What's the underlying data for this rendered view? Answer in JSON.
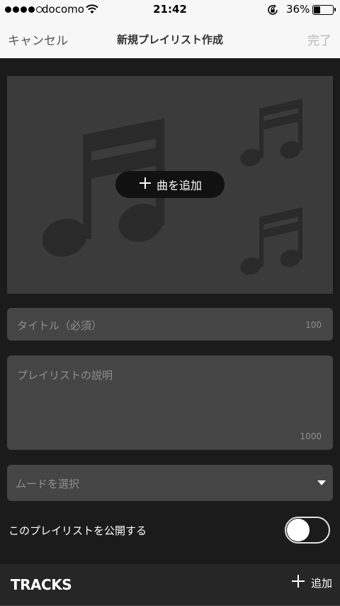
{
  "status_bar": {
    "carrier": "docomo",
    "time": "21:42",
    "battery_percent": "36%",
    "battery_level": 0.36,
    "signal_bars_filled": 4
  },
  "nav": {
    "cancel_label": "キャンセル",
    "title": "新規プレイリスト作成",
    "done_label": "完了"
  },
  "artwork": {
    "add_song_label": "曲を追加"
  },
  "form": {
    "title_placeholder": "タイトル（必須）",
    "title_max": "100",
    "description_placeholder": "プレイリストの説明",
    "description_max": "1000",
    "mood_placeholder": "ムードを選択",
    "public_label": "このプレイリストを公開する",
    "public_enabled": false
  },
  "tracks": {
    "header": "TRACKS",
    "add_label": "追加"
  },
  "colors": {
    "background": "#1b1b1b",
    "field": "#454545",
    "artwork": "#3b3b3b",
    "nav_bar": "#f7f7f7"
  },
  "icons": [
    "wifi-icon",
    "rotation-lock-icon",
    "battery-icon",
    "music-note-icon",
    "plus-icon",
    "chevron-down-icon"
  ]
}
